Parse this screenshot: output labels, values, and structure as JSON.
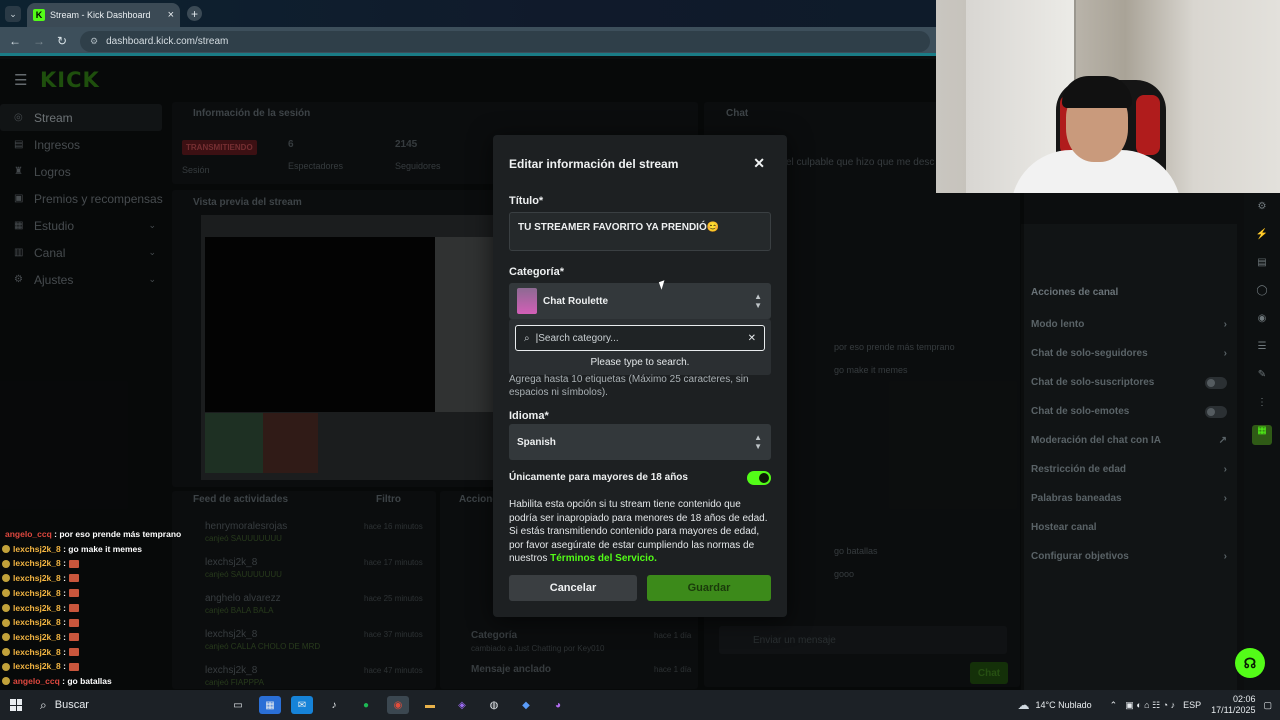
{
  "browser": {
    "tab_title": "Stream - Kick Dashboard",
    "url": "dashboard.kick.com/stream"
  },
  "dashboard": {
    "logo": "KICK",
    "sidebar": [
      {
        "label": "Stream",
        "icon": "stream-icon",
        "active": true
      },
      {
        "label": "Ingresos",
        "icon": "revenue-icon"
      },
      {
        "label": "Logros",
        "icon": "trophy-icon"
      },
      {
        "label": "Premios y recompensas",
        "icon": "gift-icon"
      },
      {
        "label": "Estudio",
        "icon": "studio-icon",
        "chevron": true
      },
      {
        "label": "Canal",
        "icon": "channel-icon",
        "chevron": true
      },
      {
        "label": "Ajustes",
        "icon": "gear-icon",
        "chevron": true
      }
    ],
    "session": {
      "title": "Información de la sesión",
      "badge": "TRANSMITIENDO",
      "session_label": "Sesión",
      "viewers_value": "6",
      "viewers_label": "Espectadores",
      "followers_value": "2145",
      "followers_label": "Seguidores"
    },
    "preview_title": "Vista previa del stream",
    "chat_title": "Chat",
    "chat_snippet": "el culpable que hizo que me desc",
    "feed": {
      "title": "Feed de actividades",
      "filter": "Filtro",
      "items": [
        {
          "user": "henrymoralesrojas",
          "sub": "canjeó SAUUUUUUU",
          "time": "hace 16 minutos"
        },
        {
          "user": "lexchsj2k_8",
          "sub": "canjeó SAUUUUUUU",
          "time": "hace 17 minutos"
        },
        {
          "user": "anghelo alvarezz",
          "sub": "canjeó BALA BALA",
          "time": "hace 25 minutos"
        },
        {
          "user": "lexchsj2k_8",
          "sub": "canjeó CALLA CHOLO DE MRD",
          "time": "hace 37 minutos"
        },
        {
          "user": "lexchsj2k_8",
          "sub": "canjeó FIAPPPA",
          "time": "hace 47 minutos"
        }
      ]
    },
    "actions_title": "Acciones",
    "actions_items": [
      {
        "label": "Categoría",
        "sub": "cambiado a Just Chatting por Key010",
        "time": "hace 1 día"
      },
      {
        "label": "Mensaje anclado",
        "sub": "",
        "time": "hace 1 día"
      }
    ],
    "channel_actions": {
      "title": "Acciones de canal",
      "rows": [
        {
          "label": "Modo lento",
          "kind": "chevron"
        },
        {
          "label": "Chat de solo-seguidores",
          "kind": "chevron"
        },
        {
          "label": "Chat de solo-suscriptores",
          "kind": "toggle"
        },
        {
          "label": "Chat de solo-emotes",
          "kind": "toggle"
        },
        {
          "label": "Moderación del chat con IA",
          "kind": "link"
        },
        {
          "label": "Restricción de edad",
          "kind": "chevron"
        },
        {
          "label": "Palabras baneadas",
          "kind": "chevron"
        },
        {
          "label": "Hostear canal",
          "kind": "none"
        },
        {
          "label": "Configurar objetivos",
          "kind": "chevron"
        }
      ]
    },
    "chat_messages": [
      "por eso prende más temprano",
      "go make it memes",
      "go batallas",
      "gooo"
    ],
    "chat_input_placeholder": "Enviar un mensaje",
    "chat_send": "Chat"
  },
  "modal": {
    "title": "Editar información del stream",
    "title_label": "Título*",
    "title_value": "TU STREAMER FAVORITO YA PRENDIÓ😊",
    "category_label": "Categoría*",
    "category_value": "Chat Roulette",
    "search_placeholder": "Search category...",
    "search_hint": "Please type to search.",
    "tags_help": "Agrega hasta 10 etiquetas (Máximo 25 caracteres, sin espacios ni símbolos).",
    "language_label": "Idioma*",
    "language_value": "Spanish",
    "adult_label": "Únicamente para mayores de 18 años",
    "adult_enabled": true,
    "adult_help": "Habilita esta opción si tu stream tiene contenido que podría ser inapropiado para menores de 18 años de edad. Si estás transmitiendo contenido para mayores de edad, por favor asegúrate de estar cumpliendo las normas de nuestros",
    "terms_link": "Términos del Servicio",
    "terms_after": ".",
    "cancel": "Cancelar",
    "save": "Guardar"
  },
  "chat_overlay": [
    {
      "user": "angelo_ccq",
      "text": "por eso prende más temprano",
      "color": "red"
    },
    {
      "user": "lexchsj2k_8",
      "text": "go make it memes"
    },
    {
      "user": "lexchsj2k_8",
      "text": "",
      "emote": true
    },
    {
      "user": "lexchsj2k_8",
      "text": "",
      "emote": true
    },
    {
      "user": "lexchsj2k_8",
      "text": "",
      "emote": true
    },
    {
      "user": "lexchsj2k_8",
      "text": "",
      "emote": true
    },
    {
      "user": "lexchsj2k_8",
      "text": "",
      "emote": true
    },
    {
      "user": "lexchsj2k_8",
      "text": "",
      "emote": true
    },
    {
      "user": "lexchsj2k_8",
      "text": "",
      "emote": true
    },
    {
      "user": "lexchsj2k_8",
      "text": "",
      "emote": true
    },
    {
      "user": "angelo_ccq",
      "text": "go batallas",
      "color": "red"
    },
    {
      "user": "angelo_ccq",
      "text": "gooo",
      "color": "red"
    }
  ],
  "taskbar": {
    "search": "Buscar",
    "weather": "14°C  Nublado",
    "lang": "ESP",
    "time": "02:06",
    "date": "17/11/2025"
  },
  "colors": {
    "accent": "#53fc18",
    "badge": "#5d1a1e"
  }
}
